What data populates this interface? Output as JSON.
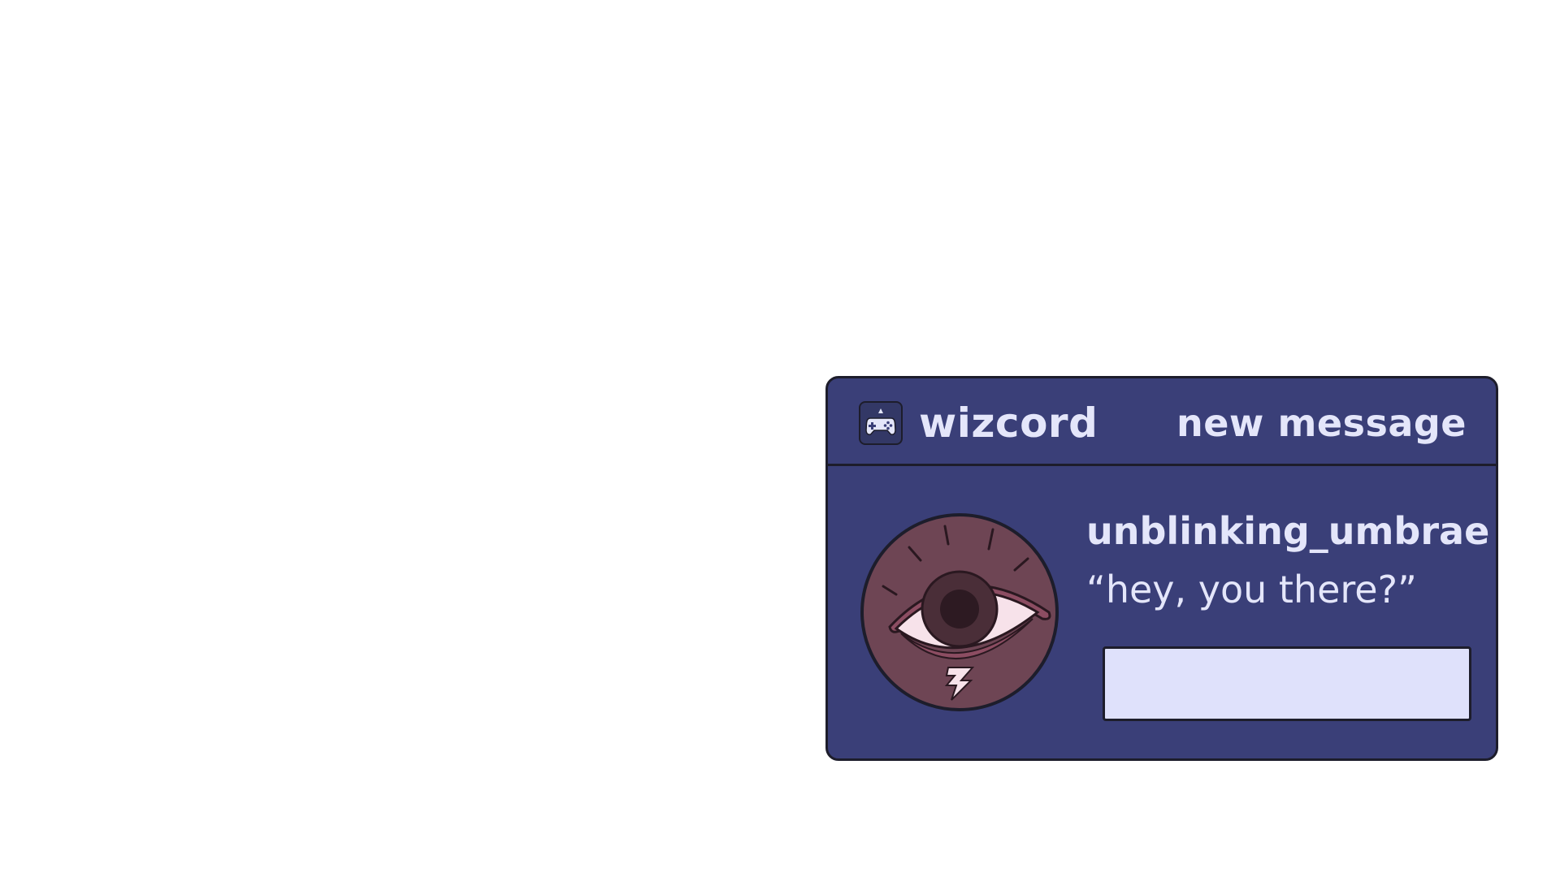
{
  "notification": {
    "app_name": "wizcord",
    "type_label": "new message",
    "app_icon": "gamepad-icon",
    "sender": "unblinking_umbrae",
    "message": "“hey, you there?”",
    "avatar_icon": "eye-icon",
    "reply": {
      "value": "",
      "placeholder": ""
    }
  },
  "colors": {
    "card_background": "#3a3f78",
    "border": "#1d1d2b",
    "text": "#e4e6fa",
    "reply_field": "#dfe1fb",
    "avatar_background": "#6e4554"
  }
}
